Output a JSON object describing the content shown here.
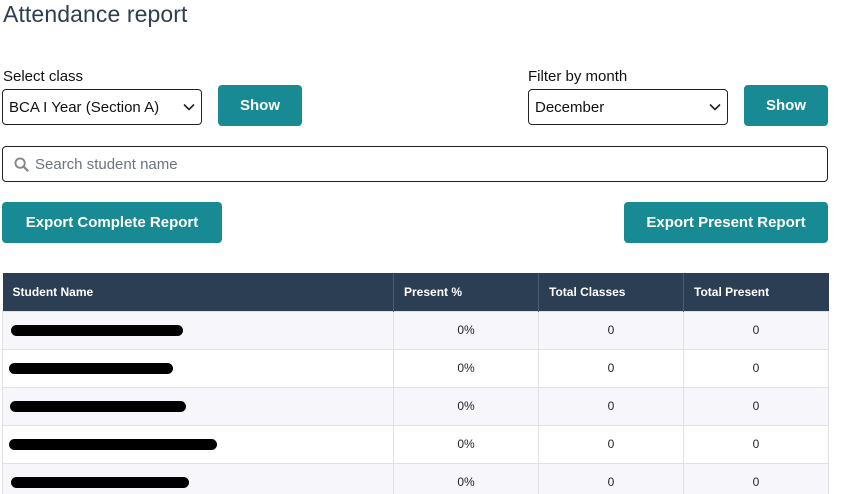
{
  "page_title": "Attendance report",
  "class_filter": {
    "label": "Select class",
    "selected": "BCA I Year (Section A)",
    "button_label": "Show"
  },
  "month_filter": {
    "label": "Filter by month",
    "selected": "December",
    "button_label": "Show"
  },
  "search": {
    "placeholder": "Search student name",
    "value": ""
  },
  "actions": {
    "export_complete": "Export Complete Report",
    "export_present": "Export Present Report"
  },
  "table": {
    "headers": [
      "Student Name",
      "Present %",
      "Total Classes",
      "Total Present"
    ],
    "rows": [
      {
        "present_pct": "0%",
        "total_classes": "0",
        "total_present": "0"
      },
      {
        "present_pct": "0%",
        "total_classes": "0",
        "total_present": "0"
      },
      {
        "present_pct": "0%",
        "total_classes": "0",
        "total_present": "0"
      },
      {
        "present_pct": "0%",
        "total_classes": "0",
        "total_present": "0"
      },
      {
        "present_pct": "0%",
        "total_classes": "0",
        "total_present": "0"
      }
    ]
  },
  "colors": {
    "accent": "#178a93",
    "header_bg": "#2b3e54",
    "title": "#2c3e50"
  }
}
